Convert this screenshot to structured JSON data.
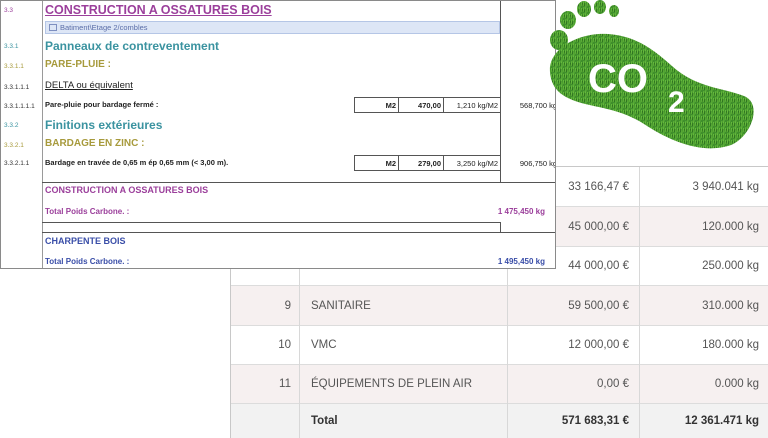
{
  "colors": {
    "purple": "#9b3f9b",
    "teal": "#3b93a0",
    "olive": "#a79a3c",
    "blue": "#3a4ea8",
    "grass": "#3e8f2a"
  },
  "doc": {
    "title_num": "3.3",
    "title": "CONSTRUCTION A OSSATURES BOIS",
    "breadcrumb": "Batiment\\Etage 2/combles",
    "s1_num": "3.3.1",
    "s1_title": "Panneaux de contreventement",
    "s11_num": "3.3.1.1",
    "s11_title": "PARE-PLUIE :",
    "s111_num": "3.3.1.1.1",
    "s111_text": "DELTA ou équivalent",
    "item1": {
      "num": "3.3.1.1.1.1",
      "text": "Pare-pluie pour bardage fermé :",
      "unit": "M2",
      "qty": "470,00",
      "factor": "1,210 kg/M2",
      "total": "568,700 kg"
    },
    "s2_num": "3.3.2",
    "s2_title": "Finitions extérieures",
    "s21_num": "3.3.2.1",
    "s21_title": "BARDAGE EN ZINC :",
    "item2": {
      "num": "3.3.2.1.1",
      "text": "Bardage en travée de 0,65 m ép 0,65 mm (< 3,00 m).",
      "unit": "M2",
      "qty": "279,00",
      "factor": "3,250 kg/M2",
      "total": "906,750 kg"
    },
    "summary1_title": "CONSTRUCTION A OSSATURES BOIS",
    "summary1_label": "Total Poids Carbone. :",
    "summary1_value": "1 475,450 kg",
    "summary2_title": "CHARPENTE BOIS",
    "summary2_label": "Total Poids Carbone. :",
    "summary2_value": "1 495,450 kg"
  },
  "table": {
    "rows": [
      {
        "num": "",
        "label": "",
        "price": "33 166,47 €",
        "carbon": "3 940.041 kg"
      },
      {
        "num": "",
        "label": "",
        "price": "45 000,00 €",
        "carbon": "120.000 kg"
      },
      {
        "num": "",
        "label": "",
        "price": "44 000,00 €",
        "carbon": "250.000 kg"
      },
      {
        "num": "9",
        "label": "SANITAIRE",
        "price": "59 500,00 €",
        "carbon": "310.000 kg"
      },
      {
        "num": "10",
        "label": "VMC",
        "price": "12 000,00 €",
        "carbon": "180.000 kg"
      },
      {
        "num": "11",
        "label": "ÉQUIPEMENTS DE PLEIN AIR",
        "price": "0,00 €",
        "carbon": "0.000 kg"
      }
    ],
    "total": {
      "label": "Total",
      "price": "571 683,31 €",
      "carbon": "12 361.471 kg"
    }
  },
  "logo": {
    "text": "CO2",
    "icon": "co2-footprint-icon"
  }
}
